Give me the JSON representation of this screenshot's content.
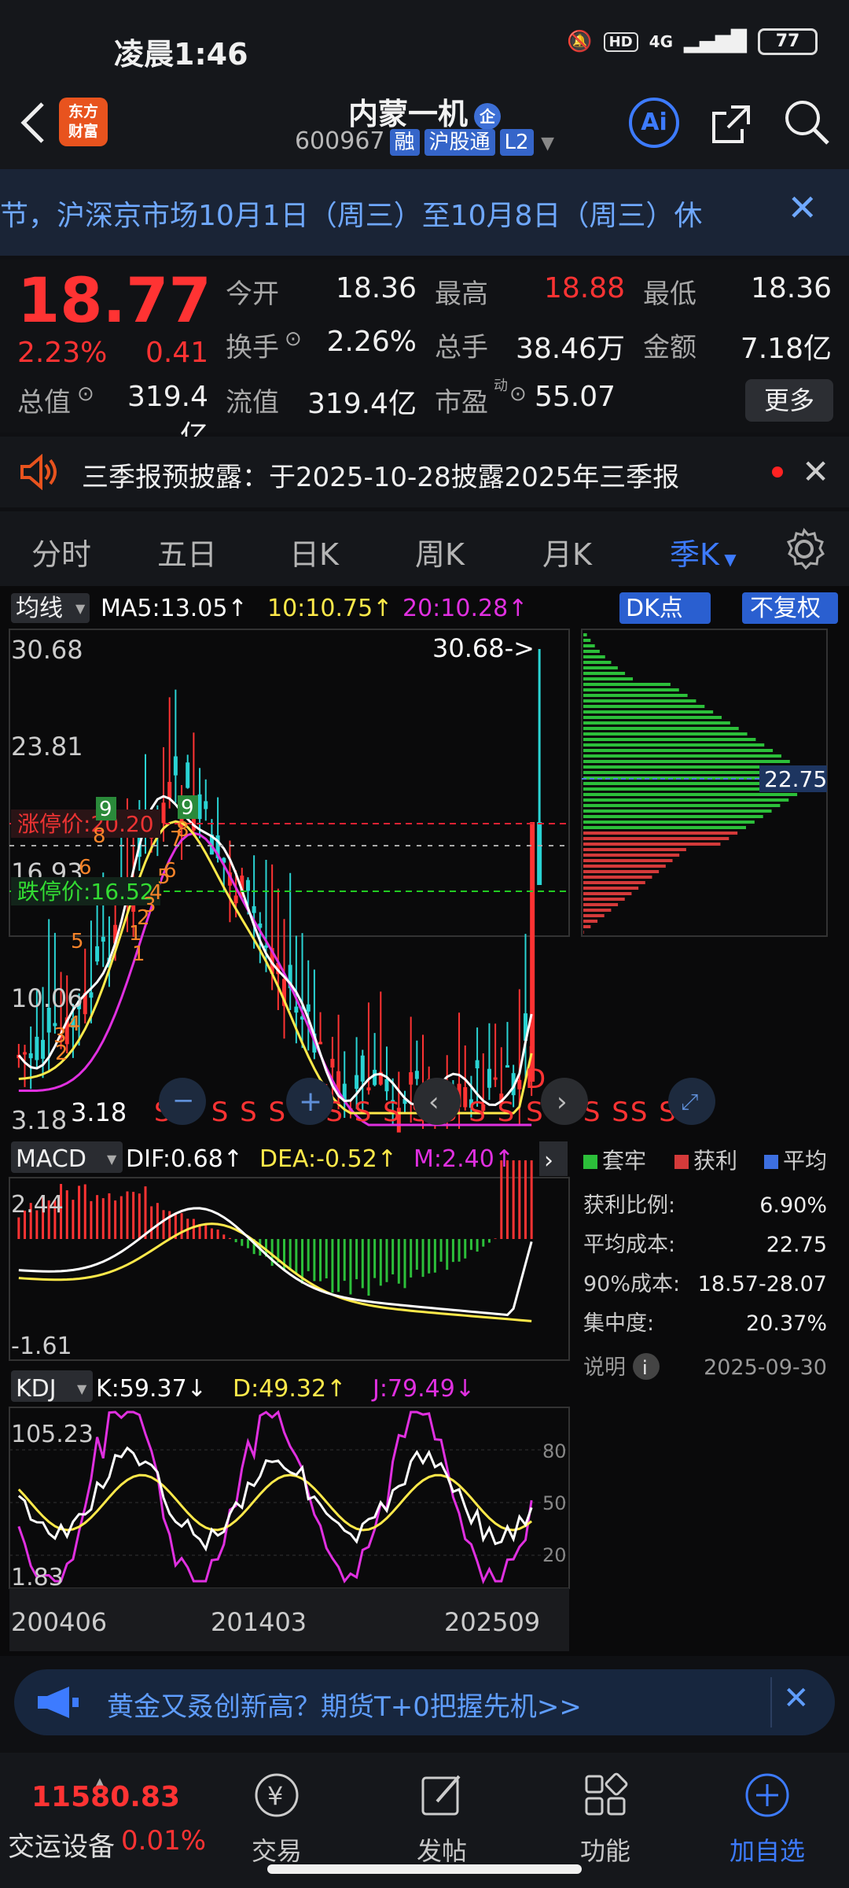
{
  "status": {
    "time": "凌晨1:46",
    "network": "4G",
    "battery": "77"
  },
  "header": {
    "brand_line1": "东方",
    "brand_line2": "财富",
    "name": "内蒙一机",
    "corp_badge": "企",
    "code": "600967",
    "tag1": "融",
    "tag2": "沪股通",
    "tag3": "L2",
    "ai": "Ai"
  },
  "notice": {
    "text": "节，沪深京市场10月1日（周三）至10月8日（周三）休"
  },
  "quote": {
    "price": "18.77",
    "pct": "2.23%",
    "change": "0.41",
    "open_label": "今开",
    "open": "18.36",
    "high_label": "最高",
    "high": "18.88",
    "low_label": "最低",
    "low": "18.36",
    "turnover_label": "换手",
    "turnover": "2.26%",
    "volume_label": "总手",
    "volume": "38.46万",
    "amount_label": "金额",
    "amount": "7.18亿",
    "mcap_label": "总值",
    "mcap": "319.4亿",
    "float_label": "流值",
    "float": "319.4亿",
    "pe_label": "市盈",
    "pe_sup": "动",
    "pe": "55.07",
    "more": "更多"
  },
  "earnings": {
    "text": "三季报预披露：于2025-10-28披露2025年三季报"
  },
  "tabs": [
    "分时",
    "五日",
    "日K",
    "周K",
    "月K",
    "季K"
  ],
  "main_chart": {
    "indicator": "均线",
    "ma5": "MA5:13.05↑",
    "ma10": "10:10.75↑",
    "ma20": "20:10.28↑",
    "dk": "DK点",
    "adj": "不复权",
    "y_ticks": [
      "30.68",
      "23.81",
      "16.93",
      "10.06",
      "3.18"
    ],
    "max_note": "30.68->",
    "min_note": "3.18",
    "limit_up": "涨停价:20.20",
    "limit_down": "跌停价:16.52",
    "d_mark": "D",
    "sell_marks": "S S S S S S S S S S S S S S S S SS S",
    "td_nums": [
      "9",
      "8",
      "6",
      "5",
      "1",
      "3",
      "2",
      "4",
      "9",
      "8",
      "7",
      "6",
      "5",
      "4",
      "3",
      "2",
      "1"
    ]
  },
  "chip": {
    "price_line": "22.75",
    "legend_trap": "套牢",
    "legend_profit": "获利",
    "legend_avg": "平均",
    "rows": [
      {
        "label": "获利比例:",
        "value": "6.90%"
      },
      {
        "label": "平均成本:",
        "value": "22.75"
      },
      {
        "label": "90%成本:",
        "value": "18.57-28.07"
      },
      {
        "label": "集中度:",
        "value": "20.37%"
      }
    ],
    "explain": "说明",
    "date": "2025-09-30"
  },
  "macd": {
    "name": "MACD",
    "dif": "DIF:0.68↑",
    "dea": "DEA:-0.52↑",
    "m": "M:2.40↑",
    "top": "2.44",
    "bottom": "-1.61"
  },
  "kdj": {
    "name": "KDJ",
    "k": "K:59.37↓",
    "d": "D:49.32↑",
    "j": "J:79.49↓",
    "top": "105.23",
    "bottom": "1.83",
    "r80": "80",
    "r50": "50",
    "r20": "20"
  },
  "x_labels": [
    "200406",
    "201403",
    "202509"
  ],
  "banner": {
    "text": "黄金又叒创新高？期货T+0把握先机>>"
  },
  "bottom": {
    "index_value": "11580.83",
    "index_name": "交运设备",
    "index_pct": "0.01%",
    "trade": "交易",
    "post": "发帖",
    "func": "功能",
    "add": "加自选"
  },
  "colors": {
    "up": "#ff3333",
    "down": "#2ad3d3",
    "accent": "#3d7bff",
    "ma5": "#ffffff",
    "ma10": "#ffe94a",
    "ma20": "#e030e0"
  }
}
